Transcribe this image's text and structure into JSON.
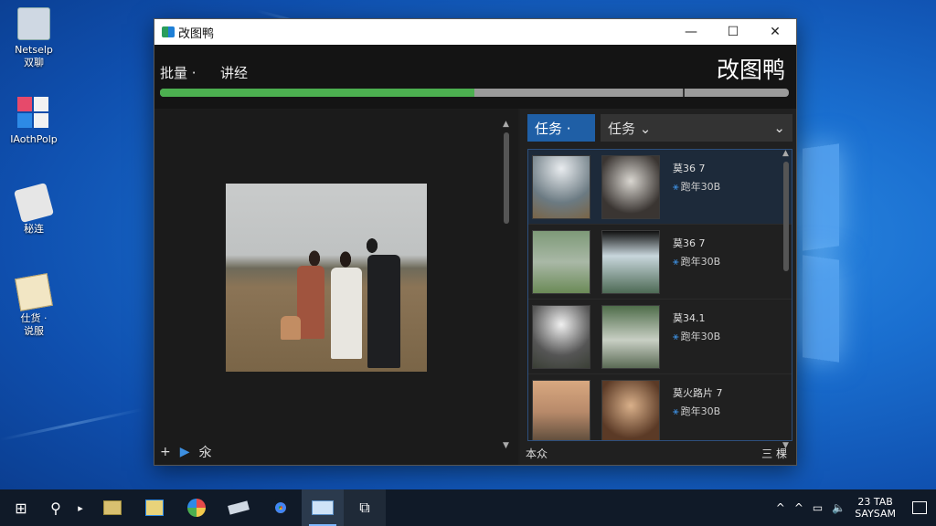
{
  "desktop": {
    "icons": [
      {
        "label1": "Netselp",
        "label2": "双聊"
      },
      {
        "label1": "IAothPolp",
        "label2": ""
      },
      {
        "label1": "秘连",
        "label2": ""
      },
      {
        "label1": "仕货 ·",
        "label2": "说服"
      }
    ]
  },
  "window": {
    "title": "改图鸭",
    "controls": {
      "minimize": "—",
      "maximize": "☐",
      "close": "✕"
    },
    "menu": {
      "batch": "批量 ·",
      "lecture": "讲经"
    },
    "brand": "改图鸭",
    "progress_fraction": 0.5,
    "left_bottom": {
      "add": "+",
      "app": "▶",
      "extra": "氽"
    },
    "right": {
      "task_button": "任务 ·",
      "task_select": "任务 ⌄",
      "select_chevron": "⌄",
      "rows": [
        {
          "line1": "莫36 7",
          "line2": "跑年30B",
          "icon": "⚹"
        },
        {
          "line1": "莫36 7",
          "line2": "跑年30B",
          "icon": "⚹"
        },
        {
          "line1": "莫34.1",
          "line2": "跑年30B",
          "icon": "⚹"
        },
        {
          "line1": "莫火路片 7",
          "line2": "跑年30B",
          "icon": "⚹"
        }
      ],
      "bottom_left": "本众",
      "bottom_right": "三 棵"
    }
  },
  "taskbar": {
    "start": "⊞",
    "search": "⚲",
    "clock_time": "23 TAB",
    "clock_date": "SAYSAM",
    "tray_icons": [
      "^",
      "^",
      "▭",
      "🔈"
    ]
  }
}
